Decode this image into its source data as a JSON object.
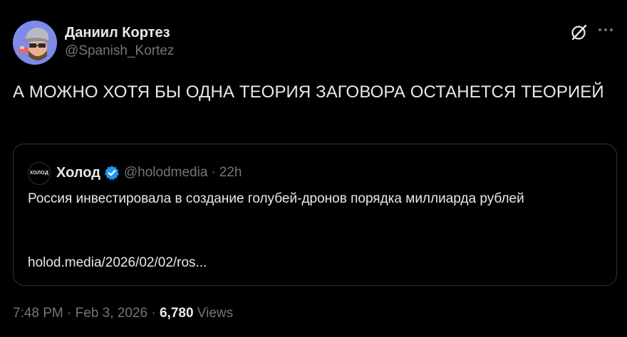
{
  "author": {
    "display_name": "Даниил Кортез",
    "handle": "@Spanish_Kortez"
  },
  "icons": {
    "grok": "grok-icon",
    "more": "more-icon",
    "verified": "verified-badge-icon"
  },
  "colors": {
    "background": "#000000",
    "text": "#e7e9ea",
    "muted": "#71767b",
    "border": "#2f3336",
    "verified": "#1d9bf0",
    "avatar_bg": "#7c8bea"
  },
  "tweet": {
    "text": "А МОЖНО ХОТЯ БЫ ОДНА ТЕОРИЯ ЗАГОВОРА ОСТАНЕТСЯ ТЕОРИЕЙ"
  },
  "quote": {
    "logo_text": "ХОЛОД",
    "name": "Холод",
    "handle": "@holodmedia",
    "separator": "·",
    "time": "22h",
    "text": "Россия инвестировала в создание голубей-дронов порядка миллиарда рублей",
    "link": "holod.media/2026/02/02/ros..."
  },
  "meta": {
    "time": "7:48 PM",
    "separator": "·",
    "date": "Feb 3, 2026",
    "views_count": "6,780",
    "views_label": "Views"
  }
}
